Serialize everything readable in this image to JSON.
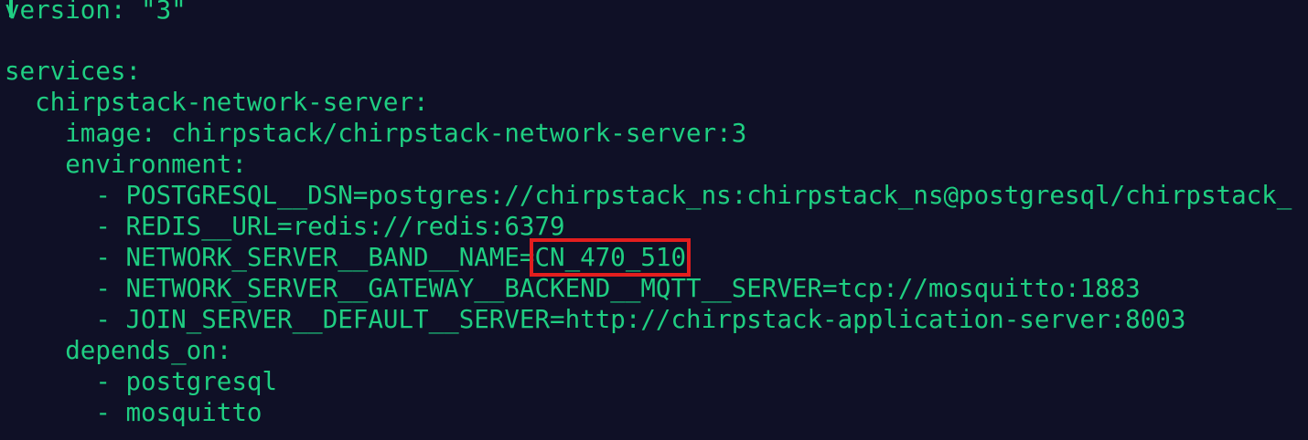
{
  "editor": {
    "lines": [
      {
        "indent": "",
        "text": "version: \"3\""
      },
      {
        "indent": "",
        "text": ""
      },
      {
        "indent": "",
        "text": "services:"
      },
      {
        "indent": "  ",
        "text": "chirpstack-network-server:"
      },
      {
        "indent": "    ",
        "text": "image: chirpstack/chirpstack-network-server:3"
      },
      {
        "indent": "    ",
        "text": "environment:"
      },
      {
        "indent": "      ",
        "text": "- POSTGRESQL__DSN=postgres://chirpstack_ns:chirpstack_ns@postgresql/chirpstack_"
      },
      {
        "indent": "      ",
        "text": "- REDIS__URL=redis://redis:6379"
      },
      {
        "indent": "      ",
        "prefix": "- NETWORK_SERVER__BAND__NAME=",
        "highlight": "CN_470_510"
      },
      {
        "indent": "      ",
        "text": "- NETWORK_SERVER__GATEWAY__BACKEND__MQTT__SERVER=tcp://mosquitto:1883"
      },
      {
        "indent": "      ",
        "text": "- JOIN_SERVER__DEFAULT__SERVER=http://chirpstack-application-server:8003"
      },
      {
        "indent": "    ",
        "text": "depends_on:"
      },
      {
        "indent": "      ",
        "text": "- postgresql"
      },
      {
        "indent": "      ",
        "text": "- mosquitto"
      }
    ]
  },
  "colors": {
    "background": "#0f1026",
    "text": "#1fce82",
    "highlight_box": "#e31e1e"
  }
}
